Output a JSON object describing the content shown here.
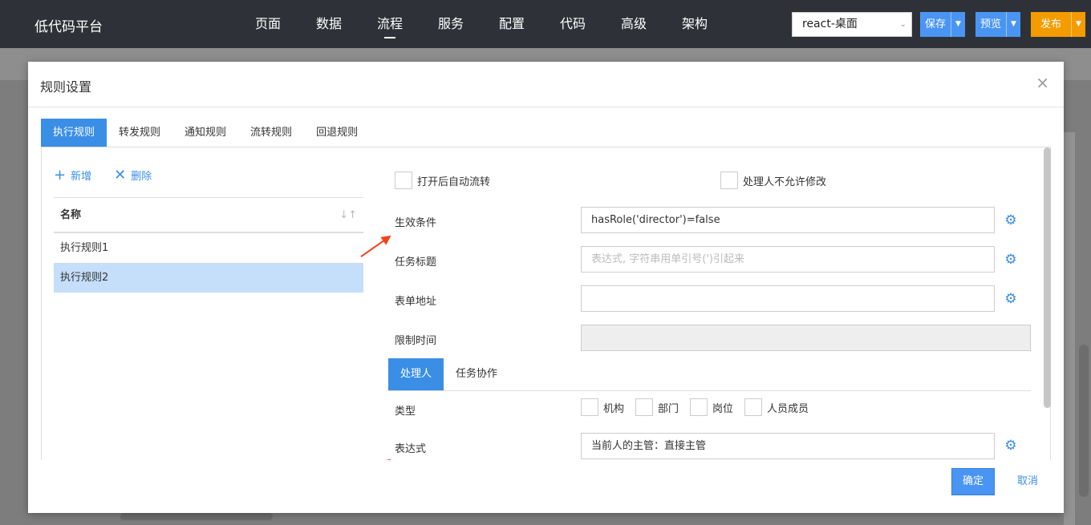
{
  "app": {
    "brand": "低代码平台"
  },
  "nav": [
    {
      "label": "页面"
    },
    {
      "label": "数据"
    },
    {
      "label": "流程",
      "active": true
    },
    {
      "label": "服务"
    },
    {
      "label": "配置"
    },
    {
      "label": "代码"
    },
    {
      "label": "高级"
    },
    {
      "label": "架构"
    }
  ],
  "header_actions": {
    "env_select": "react-桌面",
    "save": "保存",
    "preview": "预览",
    "publish": "发布"
  },
  "modal": {
    "title": "规则设置",
    "close": "×",
    "tabs": [
      "执行规则",
      "转发规则",
      "通知规则",
      "流转规则",
      "回退规则"
    ],
    "list": {
      "add": "新增",
      "delete": "删除",
      "column": "名称",
      "rows": [
        "执行规则1",
        "执行规则2"
      ],
      "selected_index": 1
    },
    "form": {
      "auto_flow": "打开后自动流转",
      "no_modify": "处理人不允许修改",
      "condition_label": "生效条件",
      "condition_value": "hasRole('director')=false",
      "task_title_label": "任务标题",
      "task_title_placeholder": "表达式, 字符串用单引号(')引起来",
      "form_url_label": "表单地址",
      "form_url_value": "",
      "time_limit_label": "限制时间",
      "sub_tabs": [
        "处理人",
        "任务协作"
      ],
      "type_label": "类型",
      "type_options": [
        "机构",
        "部门",
        "岗位",
        "人员成员"
      ],
      "expression_label": "表达式",
      "expression_value": "当前人的主管：直接主管"
    },
    "footer": {
      "ok": "确定",
      "cancel": "取消"
    }
  },
  "colors": {
    "primary": "#3a8ee6",
    "orange": "#f49b00",
    "topbar": "#2e3238",
    "selected_row": "#c5def9",
    "arrow": "#f2431d"
  }
}
